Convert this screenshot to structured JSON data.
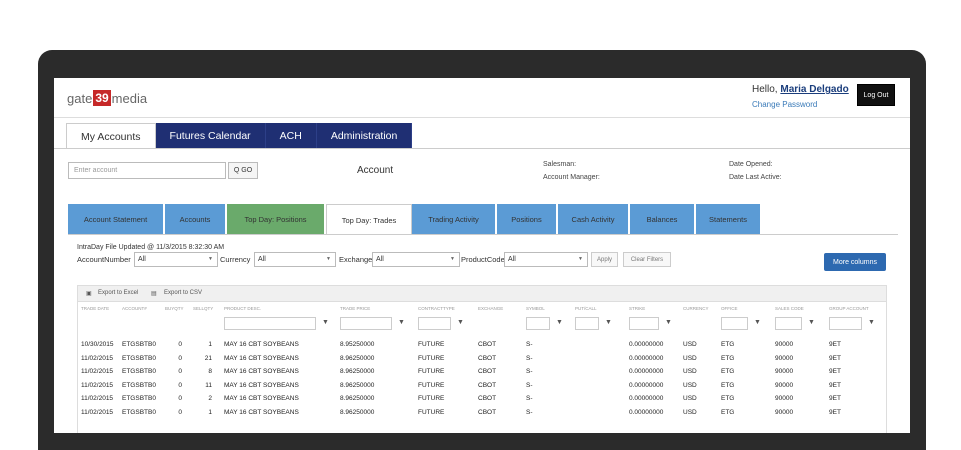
{
  "app": {
    "logo_pre": "gate",
    "logo_num": "39",
    "logo_post": "media",
    "hello_prefix": "Hello,",
    "user_name": "Maria Delgado",
    "change_password": "Change Password",
    "logout": "Log Out"
  },
  "main_nav": [
    "My Accounts",
    "Futures Calendar",
    "ACH",
    "Administration"
  ],
  "search": {
    "placeholder": "Enter account",
    "go": "Q GO",
    "account_label": "Account",
    "salesman": "Salesman:",
    "account_manager": "Account Manager:",
    "date_opened": "Date Opened:",
    "date_last_active": "Date Last Active:"
  },
  "sub_tabs": [
    "Account Statement",
    "Accounts",
    "Top Day: Positions",
    "Top Day: Trades",
    "Trading Activity",
    "Positions",
    "Cash Activity",
    "Balances",
    "Statements"
  ],
  "file_updated": "IntraDay File Updated @ 11/3/2015 8:32:30 AM",
  "filters": {
    "account_number_label": "AccountNumber",
    "account_number_value": "All",
    "currency_label": "Currency",
    "currency_value": "All",
    "exchange_label": "Exchange",
    "exchange_value": "All",
    "product_code_label": "ProductCode",
    "product_code_value": "All",
    "apply": "Apply",
    "clear": "Clear Filters",
    "more_columns": "More columns"
  },
  "export": {
    "excel": "Export to Excel",
    "csv": "Export to CSV"
  },
  "table": {
    "headers": [
      "TRADE DATE",
      "ACCOUNT#",
      "BUYQTY",
      "SELLQTY",
      "PRODUCT DESC.",
      "TRADE PRICE",
      "CONTRACTTYPE",
      "EXCHANGE",
      "SYMBOL",
      "PUT/CALL",
      "STRIKE",
      "CURRENCY",
      "OFFICE",
      "SALES CODE",
      "GROUP ACCOUNT"
    ],
    "rows": [
      [
        "10/30/2015",
        "ETGSBTB0",
        "0",
        "1",
        "MAY 16 CBT SOYBEANS",
        "8.95250000",
        "FUTURE",
        "CBOT",
        "S-",
        "",
        "0.00000000",
        "USD",
        "ETG",
        "90000",
        "9ET"
      ],
      [
        "11/02/2015",
        "ETGSBTB0",
        "0",
        "21",
        "MAY 16 CBT SOYBEANS",
        "8.96250000",
        "FUTURE",
        "CBOT",
        "S-",
        "",
        "0.00000000",
        "USD",
        "ETG",
        "90000",
        "9ET"
      ],
      [
        "11/02/2015",
        "ETGSBTB0",
        "0",
        "8",
        "MAY 16 CBT SOYBEANS",
        "8.96250000",
        "FUTURE",
        "CBOT",
        "S-",
        "",
        "0.00000000",
        "USD",
        "ETG",
        "90000",
        "9ET"
      ],
      [
        "11/02/2015",
        "ETGSBTB0",
        "0",
        "11",
        "MAY 16 CBT SOYBEANS",
        "8.96250000",
        "FUTURE",
        "CBOT",
        "S-",
        "",
        "0.00000000",
        "USD",
        "ETG",
        "90000",
        "9ET"
      ],
      [
        "11/02/2015",
        "ETGSBTB0",
        "0",
        "2",
        "MAY 16 CBT SOYBEANS",
        "8.96250000",
        "FUTURE",
        "CBOT",
        "S-",
        "",
        "0.00000000",
        "USD",
        "ETG",
        "90000",
        "9ET"
      ],
      [
        "11/02/2015",
        "ETGSBTB0",
        "0",
        "1",
        "MAY 16 CBT SOYBEANS",
        "8.96250000",
        "FUTURE",
        "CBOT",
        "S-",
        "",
        "0.00000000",
        "USD",
        "ETG",
        "90000",
        "9ET"
      ]
    ]
  },
  "colors": {
    "nav_dark": "#1f2f73",
    "tab_blue": "#5b9bd5",
    "tab_green": "#6aaa6b",
    "button_blue": "#2d69b0",
    "logo_red": "#c62828"
  }
}
